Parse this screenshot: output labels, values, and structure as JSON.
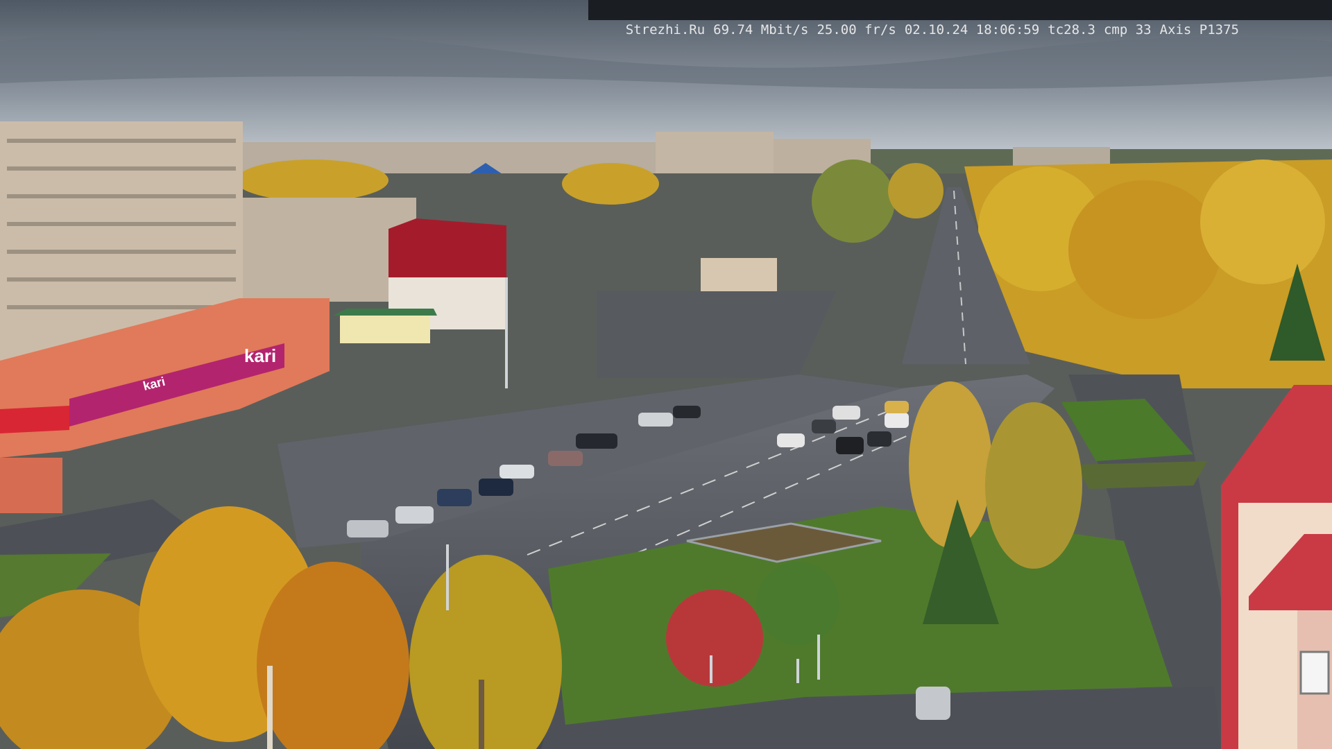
{
  "camera_overlay": {
    "site": "Strezhi.Ru",
    "bitrate": "69.74 Mbit/s",
    "framerate": "25.00 fr/s",
    "datetime": "02.10.24 18:06:59",
    "tc": "tc28.3",
    "cmp": "cmp 33",
    "camera_model": "Axis P1375"
  },
  "store_signs": {
    "brand_left": "kari",
    "brand_right": "kari"
  },
  "colors": {
    "sky_top": "#5c6773",
    "sky_bottom": "#c3c9cf",
    "road": "#4a4e54",
    "grass": "#4f7a2c",
    "autumn_tree": "#d3a120",
    "store_facade": "#e07a5a",
    "store_banner": "#b3246e",
    "right_building": "#c93a45"
  }
}
